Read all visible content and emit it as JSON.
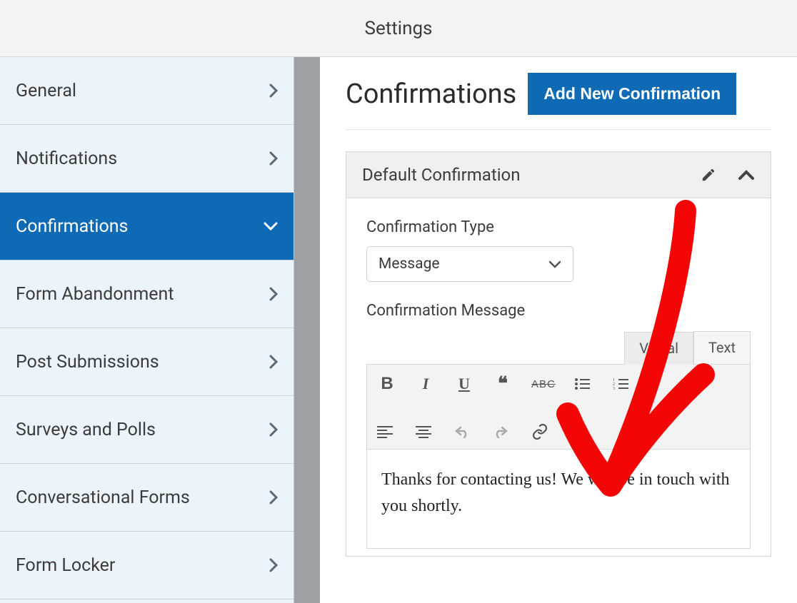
{
  "header": {
    "title": "Settings"
  },
  "sidebar": {
    "items": [
      {
        "label": "General",
        "active": false
      },
      {
        "label": "Notifications",
        "active": false
      },
      {
        "label": "Confirmations",
        "active": true
      },
      {
        "label": "Form Abandonment",
        "active": false
      },
      {
        "label": "Post Submissions",
        "active": false
      },
      {
        "label": "Surveys and Polls",
        "active": false
      },
      {
        "label": "Conversational Forms",
        "active": false
      },
      {
        "label": "Form Locker",
        "active": false
      }
    ]
  },
  "main": {
    "title": "Confirmations",
    "add_button": "Add New Confirmation",
    "panel": {
      "title": "Default Confirmation",
      "type_label": "Confirmation Type",
      "type_value": "Message",
      "message_label": "Confirmation Message",
      "tabs": {
        "visual": "Visual",
        "text": "Text"
      },
      "toolbar": {
        "bold": "B",
        "italic": "I",
        "underline": "U",
        "quote": "❝",
        "strike": "ABC"
      },
      "content": "Thanks for contacting us! We will be in touch with you shortly."
    }
  },
  "colors": {
    "accent": "#0f6ab5",
    "annotation": "#f40606"
  }
}
